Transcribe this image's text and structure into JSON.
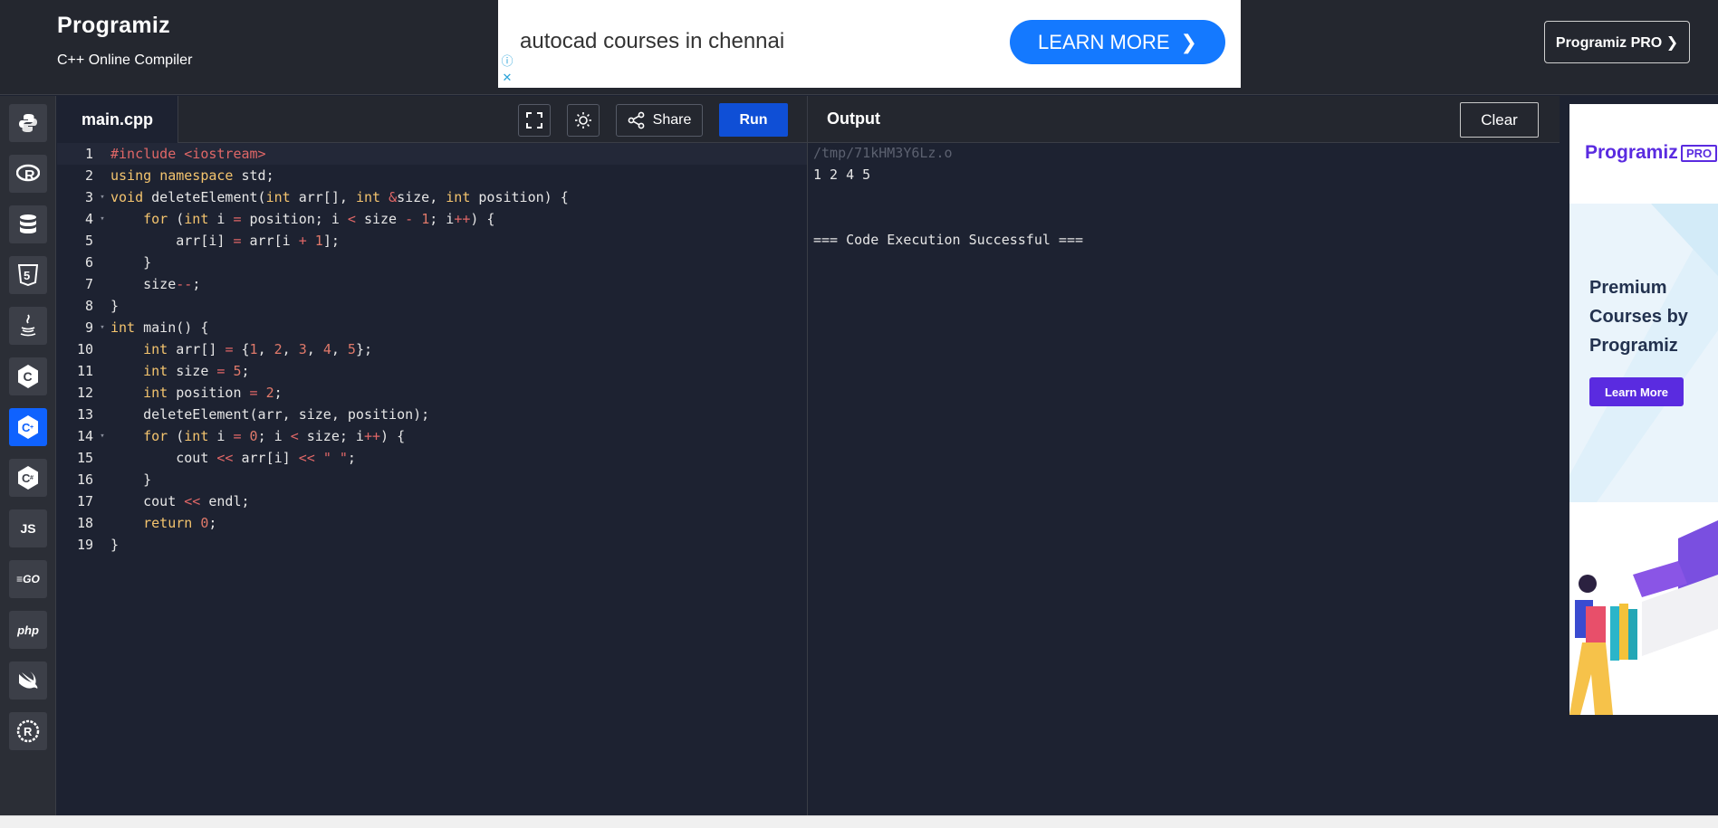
{
  "header": {
    "logo": "Programiz",
    "subtitle": "C++ Online Compiler",
    "pro_button": "Programiz PRO ❯"
  },
  "top_ad": {
    "text": "autocad courses in chennai",
    "button": "LEARN MORE",
    "info_icon": "info-icon",
    "close_icon": "close-icon"
  },
  "languages": [
    {
      "name": "python-icon",
      "glyph": "🐍"
    },
    {
      "name": "r-icon",
      "glyph": "R"
    },
    {
      "name": "sql-icon",
      "glyph": "🛢"
    },
    {
      "name": "html5-icon",
      "glyph": "5"
    },
    {
      "name": "java-icon",
      "glyph": "☕"
    },
    {
      "name": "c-icon",
      "glyph": "C"
    },
    {
      "name": "cpp-icon",
      "glyph": "C"
    },
    {
      "name": "csharp-icon",
      "glyph": "C"
    },
    {
      "name": "js-icon",
      "glyph": "JS"
    },
    {
      "name": "go-icon",
      "glyph": "GO"
    },
    {
      "name": "php-icon",
      "glyph": "php"
    },
    {
      "name": "swift-icon",
      "glyph": "🕊"
    },
    {
      "name": "rust-icon",
      "glyph": "R"
    }
  ],
  "editor": {
    "file_name": "main.cpp",
    "share_label": "Share",
    "run_label": "Run",
    "lines": [
      "1",
      "2",
      "3",
      "4",
      "5",
      "6",
      "7",
      "8",
      "9",
      "10",
      "11",
      "12",
      "13",
      "14",
      "15",
      "16",
      "17",
      "18",
      "19"
    ]
  },
  "output": {
    "title": "Output",
    "clear_label": "Clear",
    "tmp_path": "/tmp/71kHM3Y6Lz.o",
    "result": "1 2 4 5",
    "status": "=== Code Execution Successful ==="
  },
  "right_ad": {
    "logo": "Programiz",
    "pro": "PRO",
    "headline": "Premium Courses by Programiz",
    "button": "Learn More"
  },
  "colors": {
    "accent": "#0f62fe",
    "run": "#0f4fd6",
    "background": "#1d2231",
    "header": "#24272f"
  }
}
